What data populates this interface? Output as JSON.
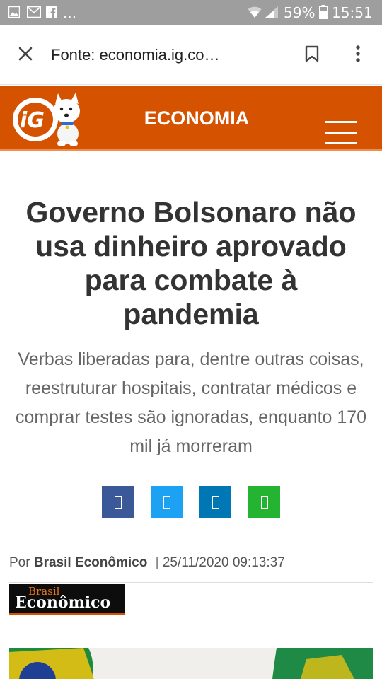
{
  "status_bar": {
    "notification_more": "...",
    "battery_text": "59%",
    "time": "15:51",
    "icons": [
      "image-icon",
      "mail-icon",
      "facebook-icon",
      "wifi-icon",
      "signal-icon",
      "battery-icon"
    ]
  },
  "toolbar": {
    "url_text": "Fonte: economia.ig.co…",
    "icons": [
      "close-icon",
      "bookmark-icon",
      "more-vert-icon"
    ]
  },
  "header": {
    "section_title": "ECONOMIA",
    "logo_text": "iG",
    "colors": {
      "background": "#d45200",
      "accent": "#ef8f4f"
    }
  },
  "article": {
    "headline": "Governo Bolsonaro não usa dinheiro aprovado para combate à pandemia",
    "subtitle": "Verbas liberadas para, dentre outras coisas, reestruturar hospitais, contratar médicos e comprar testes são ignoradas, enquanto 170 mil já morreram",
    "byline_prefix": "Por",
    "author": "Brasil Econômico",
    "separator": "|",
    "timestamp": "25/11/2020 09:13:37"
  },
  "share_buttons": [
    {
      "name": "facebook",
      "color": "#3b5998"
    },
    {
      "name": "twitter",
      "color": "#1da1f2"
    },
    {
      "name": "linkedin",
      "color": "#0077b5"
    },
    {
      "name": "whatsapp",
      "color": "#25b332"
    }
  ],
  "source_logo": {
    "line1": "Brasil",
    "line2": "Econômico"
  }
}
